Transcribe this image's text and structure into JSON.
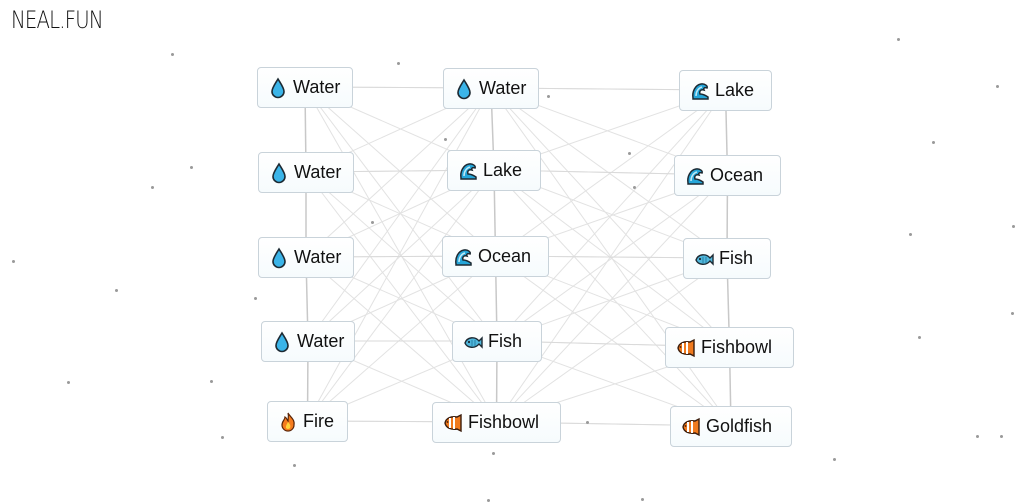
{
  "logo": "NEAL.FUN",
  "colors": {
    "item_border": "#c9d3da",
    "line": "#d6d6d6"
  },
  "items": [
    {
      "id": "w1",
      "label": "Water",
      "icon": "water-drop-icon"
    },
    {
      "id": "w2",
      "label": "Water",
      "icon": "water-drop-icon"
    },
    {
      "id": "w3",
      "label": "Water",
      "icon": "water-drop-icon"
    },
    {
      "id": "w4",
      "label": "Water",
      "icon": "water-drop-icon"
    },
    {
      "id": "fire",
      "label": "Fire",
      "icon": "fire-icon"
    },
    {
      "id": "w5",
      "label": "Water",
      "icon": "water-drop-icon"
    },
    {
      "id": "lake1",
      "label": "Lake",
      "icon": "wave-icon"
    },
    {
      "id": "ocean1",
      "label": "Ocean",
      "icon": "wave-icon"
    },
    {
      "id": "fish1",
      "label": "Fish",
      "icon": "fish-icon"
    },
    {
      "id": "bowl1",
      "label": "Fishbowl",
      "icon": "tropical-fish-icon"
    },
    {
      "id": "lake2",
      "label": "Lake",
      "icon": "wave-icon"
    },
    {
      "id": "ocean2",
      "label": "Ocean",
      "icon": "wave-icon"
    },
    {
      "id": "fish2",
      "label": "Fish",
      "icon": "fish-icon"
    },
    {
      "id": "bowl2",
      "label": "Fishbowl",
      "icon": "tropical-fish-icon"
    },
    {
      "id": "goldfish",
      "label": "Goldfish",
      "icon": "tropical-fish-icon"
    }
  ]
}
